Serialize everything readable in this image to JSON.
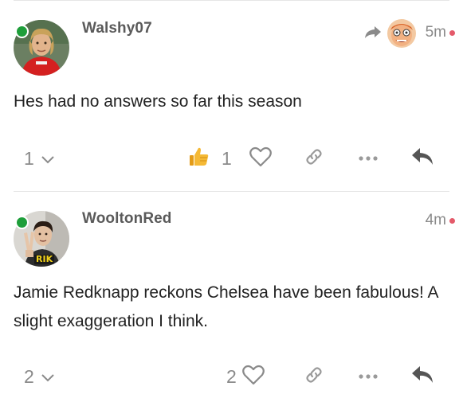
{
  "posts": [
    {
      "username": "Walshy07",
      "age": "5m",
      "body": "Hes had no answers so far this season",
      "replies_count": "1",
      "reaction_count": "1",
      "has_reply_to": true
    },
    {
      "username": "WooltonRed",
      "age": "4m",
      "body": "Jamie Redknapp reckons Chelsea have been fabulous! A slight exaggeration I think.",
      "replies_count": "2",
      "like_count": "2",
      "avatar_badge": "RIK"
    }
  ],
  "colors": {
    "online": "#1e9e3a",
    "unread": "#e45a6a",
    "muted_text": "#8a8a8a",
    "username": "#5a5a5a",
    "divider": "#e6e6e6"
  },
  "icons": {
    "reply_to": "share-arrow-icon",
    "expand": "chevron-down-icon",
    "reaction": "thumbs-up-icon",
    "like": "heart-icon",
    "link": "link-icon",
    "more": "ellipsis-icon",
    "reply": "reply-arrow-icon"
  }
}
